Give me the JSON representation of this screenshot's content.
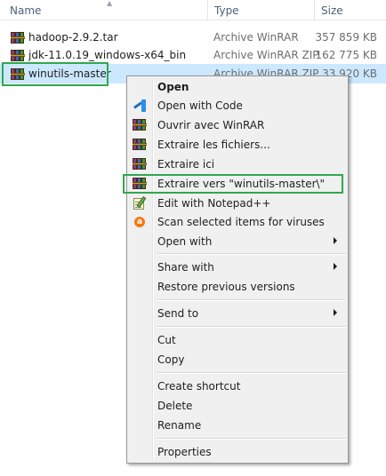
{
  "columns": {
    "name": "Name",
    "type": "Type",
    "size": "Size"
  },
  "files": [
    {
      "name": "hadoop-2.9.2.tar",
      "type": "Archive WinRAR",
      "size": "357 859 KB"
    },
    {
      "name": "jdk-11.0.19_windows-x64_bin",
      "type": "Archive WinRAR ZIP",
      "size": "162 775 KB"
    },
    {
      "name": "winutils-master",
      "type": "Archive WinRAR ZIP",
      "size": "33 920 KB"
    }
  ],
  "menu": {
    "open": "Open",
    "open_with_code": "Open with Code",
    "ouvrir_winrar": "Ouvrir avec WinRAR",
    "extraire_fichiers": "Extraire les fichiers...",
    "extraire_ici": "Extraire ici",
    "extraire_vers": "Extraire vers \"winutils-master\\\"",
    "edit_notepad": "Edit with Notepad++",
    "scan_viruses": "Scan selected items for viruses",
    "open_with": "Open with",
    "share_with": "Share with",
    "restore_versions": "Restore previous versions",
    "send_to": "Send to",
    "cut": "Cut",
    "copy": "Copy",
    "create_shortcut": "Create shortcut",
    "delete": "Delete",
    "rename": "Rename",
    "properties": "Properties"
  },
  "colors": {
    "selection": "#cce8ff",
    "highlight_outline": "#2fa84f",
    "menu_bg": "#f0f0f0"
  }
}
